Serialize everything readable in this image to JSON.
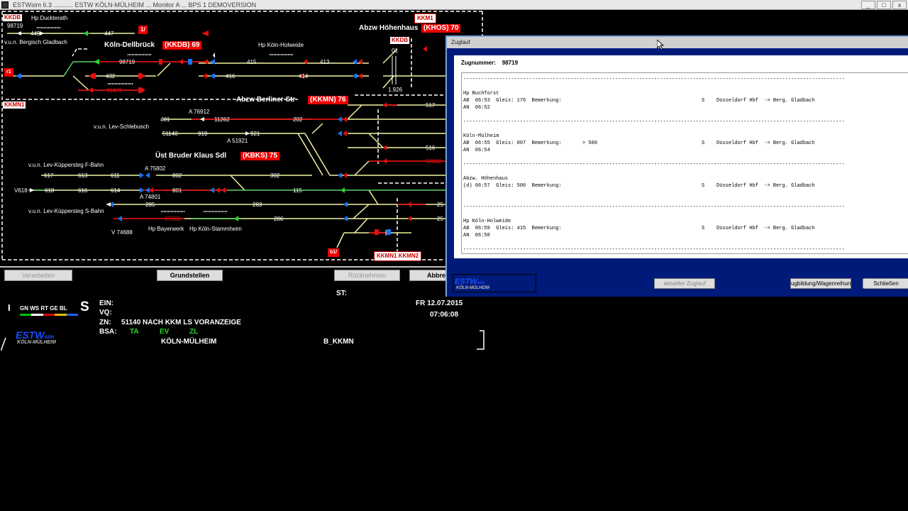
{
  "window": {
    "title": "ESTWsim 6.3 ........... ESTW KÖLN-MÜLHEIM ... Monitor A ... BPS 1  DEMOVERSION",
    "controls": [
      "_",
      "□",
      "x"
    ]
  },
  "diagram": {
    "labels": {
      "kkdb_top": "KKDB",
      "hp_duckterath": "Hp Duckterath",
      "n98719_top": "98719",
      "n449": "449",
      "n447": "447",
      "tag_1": "1/",
      "vun_berg": "v.u.n. Bergisch Gladbach",
      "koeln_dellbrueck": "Köln-Dellbrück",
      "kkdb69": "(KKDB) 69",
      "hp_holweide": "Hp Köln-Holweide",
      "abzw_hoehenhaus": "Abzw Höhenhaus",
      "khos70": "(KHOS) 70",
      "kkm1_top": "KKM1",
      "kkdb_mid": "KKDB",
      "n01": "01",
      "n98719_mid": "98719",
      "n432": "432",
      "n11429": "11429",
      "n415": "415",
      "n413": "413",
      "n416": "416",
      "n414": "414",
      "n1926": "1.926",
      "tag_r1": "r1",
      "kkmn1_left": "KKMN1",
      "abzw_berliner": "Abzw Berliner Str",
      "kkmn76": "(KKMN) 76",
      "n517": "517",
      "a76912": "A 76912",
      "n401": "401",
      "n11262": "11262",
      "n202": "202",
      "vun_schlebusch": "v.u.n. Lev-Schlebusch",
      "n51140": "51140",
      "n919": "919",
      "n921": "921",
      "a51921": "A 51921",
      "n516": "516",
      "uest_bruder": "Üst Bruder Klaus Sdl",
      "kbks75": "(KBKS) 75",
      "n50812": "50812",
      "vun_fbahn": "v.u.n. Lev-Küppersteg F-Bahn",
      "a75802": "A 75802",
      "n617": "617",
      "n613": "613",
      "n611": "611",
      "n802": "802",
      "n302": "302",
      "v618": "V618",
      "n618": "618",
      "n616": "616",
      "n614": "614",
      "n801": "801",
      "n115": "115",
      "a74801": "A 74801",
      "n285": "285",
      "n283": "283",
      "vun_sbahn": "v.u.n. Lev-Küppersteg S-Bahn",
      "n97822": "97822",
      "n286": "286",
      "n25a": "25",
      "n25b": "25",
      "v74688": "V 74688",
      "hp_bayerwerk": "Hp Bayerwerk",
      "hp_stammheim": "Hp Köln-Stammheim",
      "tag_b1": "b1/",
      "kkmn1_kkmn2": "KKMN1  KKMN2"
    }
  },
  "buttons": {
    "verarbeiten": "Verarbeiten",
    "grundstellen": "Grundstellen",
    "ruecknehmen": "Rücknehmen",
    "abbrechen": "Abbre"
  },
  "status": {
    "i": "I",
    "lamps": [
      "GN",
      "WS",
      "RT",
      "GE",
      "BL"
    ],
    "lamp_colors": [
      "#00c000",
      "#ffffff",
      "#e00000",
      "#e0c000",
      "#2060ff"
    ],
    "s": "S",
    "ein_label": "EIN:",
    "vq_label": "VQ:",
    "zn_label": "ZN:",
    "zn_value": "51140 NACH KKM LS  VORANZEIGE",
    "bsa_label": "BSA:",
    "bsa_items": [
      "TA",
      "EV",
      "ZL"
    ],
    "st_label": "ST:",
    "day_date": "FR  12.07.2015",
    "time": "07:06:08",
    "station": "KÖLN-MÜLHEIM",
    "bkkmn": "B_KKMN",
    "logo_main": "ESTW",
    "logo_sim": "sim",
    "logo_sub": "KÖLN-MÜLHEIM"
  },
  "zuglauf": {
    "title": "Zuglauf",
    "zugnummer_label": "Zugnummer:",
    "zugnummer": "98719",
    "entries": [
      {
        "name": "Hp Buchforst",
        "line1": "AB  06:53  Gleis: 176  Bemerkung:",
        "line2": "AN  06:52",
        "dir": "S",
        "route": "Düsseldorf Hbf  -> Berg. Gladbach",
        "note": ""
      },
      {
        "name": "Köln-Mülheim",
        "line1": "AB  06:55  Gleis: 007  Bemerkung:",
        "line2": "AN  06:54",
        "dir": "S",
        "route": "Düsseldorf Hbf  -> Berg. Gladbach",
        "note": "> 506"
      },
      {
        "name": "Abzw. Höhenhaus",
        "line1": "(d) 06:57  Gleis: 506  Bemerkung:",
        "line2": "",
        "dir": "S",
        "route": "Düsseldorf Hbf  -> Berg. Gladbach",
        "note": ""
      },
      {
        "name": "Hp Köln-Holweide",
        "line1": "AB  06:59  Gleis: 415  Bemerkung:",
        "line2": "AN  06:58",
        "dir": "S",
        "route": "Düsseldorf Hbf  -> Berg. Gladbach",
        "note": ""
      }
    ],
    "btn_aktuell": "aktueller Zuglauf",
    "btn_zugbildung": "ugbildung/Wagenreihun",
    "btn_schliessen": "Schließen",
    "logo_main": "ESTW",
    "logo_sim": "sim",
    "logo_sub": "KÖLN-MÜLHEIM"
  }
}
